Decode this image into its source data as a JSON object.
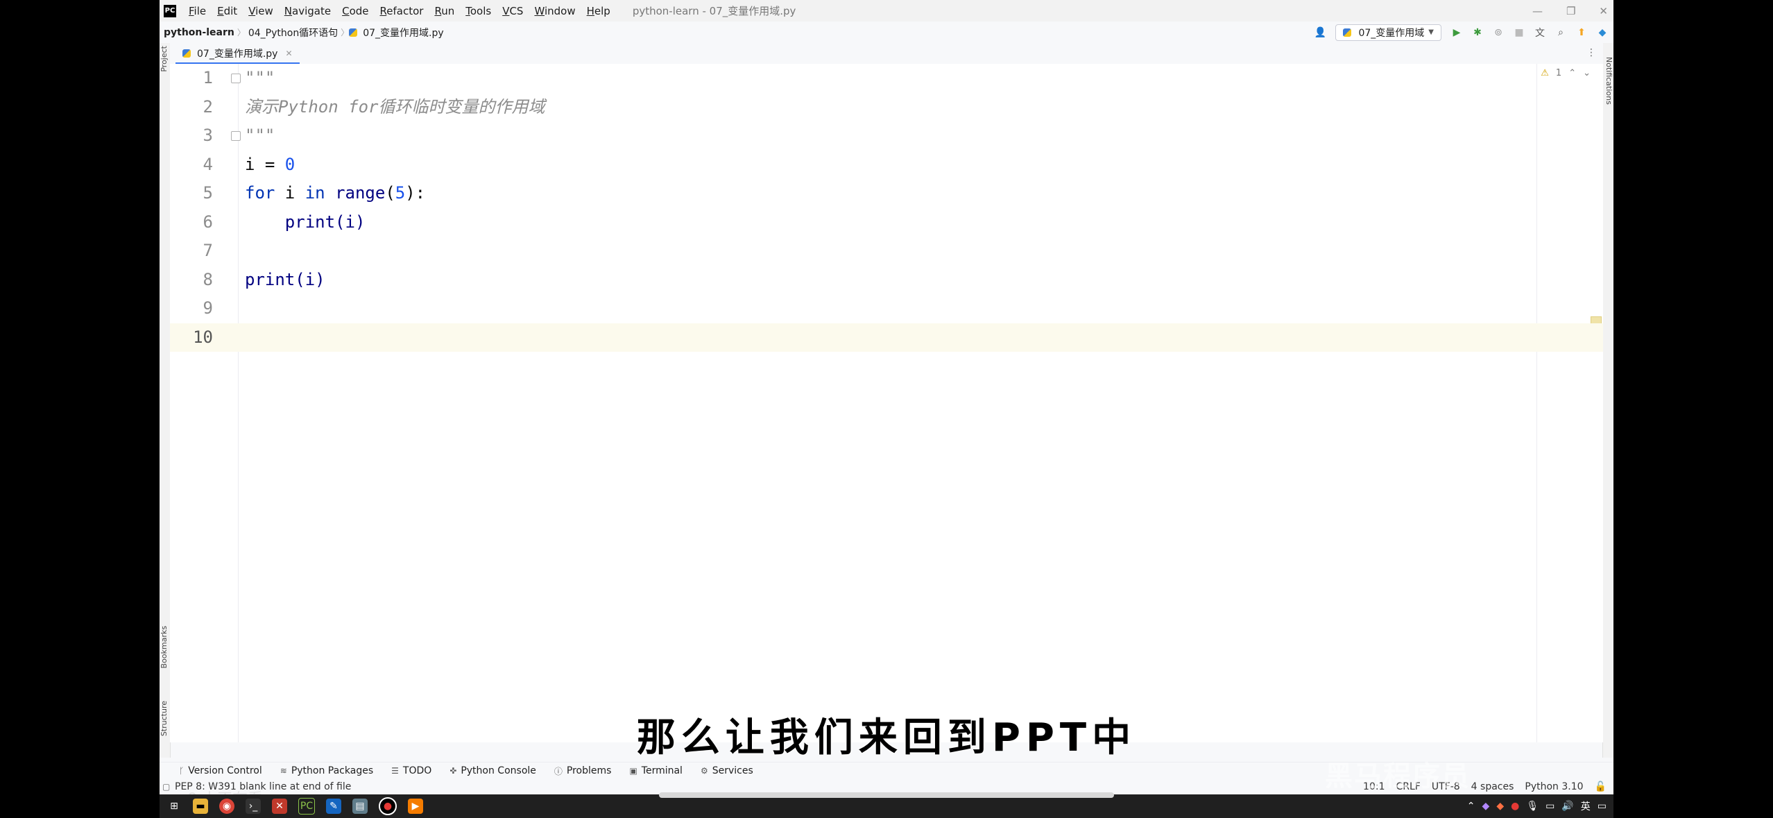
{
  "titlebar": {
    "menu": [
      "File",
      "Edit",
      "View",
      "Navigate",
      "Code",
      "Refactor",
      "Run",
      "Tools",
      "VCS",
      "Window",
      "Help"
    ],
    "window_title": "python-learn - 07_变量作用域.py",
    "buttons": {
      "minimize": "—",
      "restore": "❐",
      "close": "✕"
    }
  },
  "breadcrumbs": [
    "python-learn",
    "04_Python循环语句",
    "07_变量作用域.py"
  ],
  "run_config": "07_变量作用域",
  "tab": {
    "label": "07_变量作用域.py",
    "close": "✕"
  },
  "editor": {
    "lines": [
      {
        "n": "1",
        "text": "\"\"\""
      },
      {
        "n": "2",
        "text": "演示Python for循环临时变量的作用域"
      },
      {
        "n": "3",
        "text": "\"\"\""
      },
      {
        "n": "4",
        "text": "i = 0"
      },
      {
        "n": "5",
        "text": "for i in range(5):"
      },
      {
        "n": "6",
        "text": "    print(i)"
      },
      {
        "n": "7",
        "text": ""
      },
      {
        "n": "8",
        "text": "print(i)"
      },
      {
        "n": "9",
        "text": ""
      },
      {
        "n": "10",
        "text": ""
      }
    ],
    "current_line": 10,
    "warning_count": "1"
  },
  "left_stripe": {
    "project": "Project",
    "bookmarks": "Bookmarks",
    "structure": "Structure"
  },
  "right_stripe": {
    "notifications": "Notifications"
  },
  "tool_windows": [
    "Version Control",
    "Python Packages",
    "TODO",
    "Python Console",
    "Problems",
    "Terminal",
    "Services"
  ],
  "status": {
    "message": "PEP 8: W391 blank line at end of file",
    "position": "10:1",
    "line_sep": "CRLF",
    "encoding": "UTF-8",
    "indent": "4 spaces",
    "interpreter": "Python 3.10"
  },
  "overlay": {
    "subtitle": "那么让我们来回到PPT中",
    "watermark": "黑马程序员",
    "viewers": "8 人正在看"
  },
  "taskbar": {
    "ime": "英"
  }
}
